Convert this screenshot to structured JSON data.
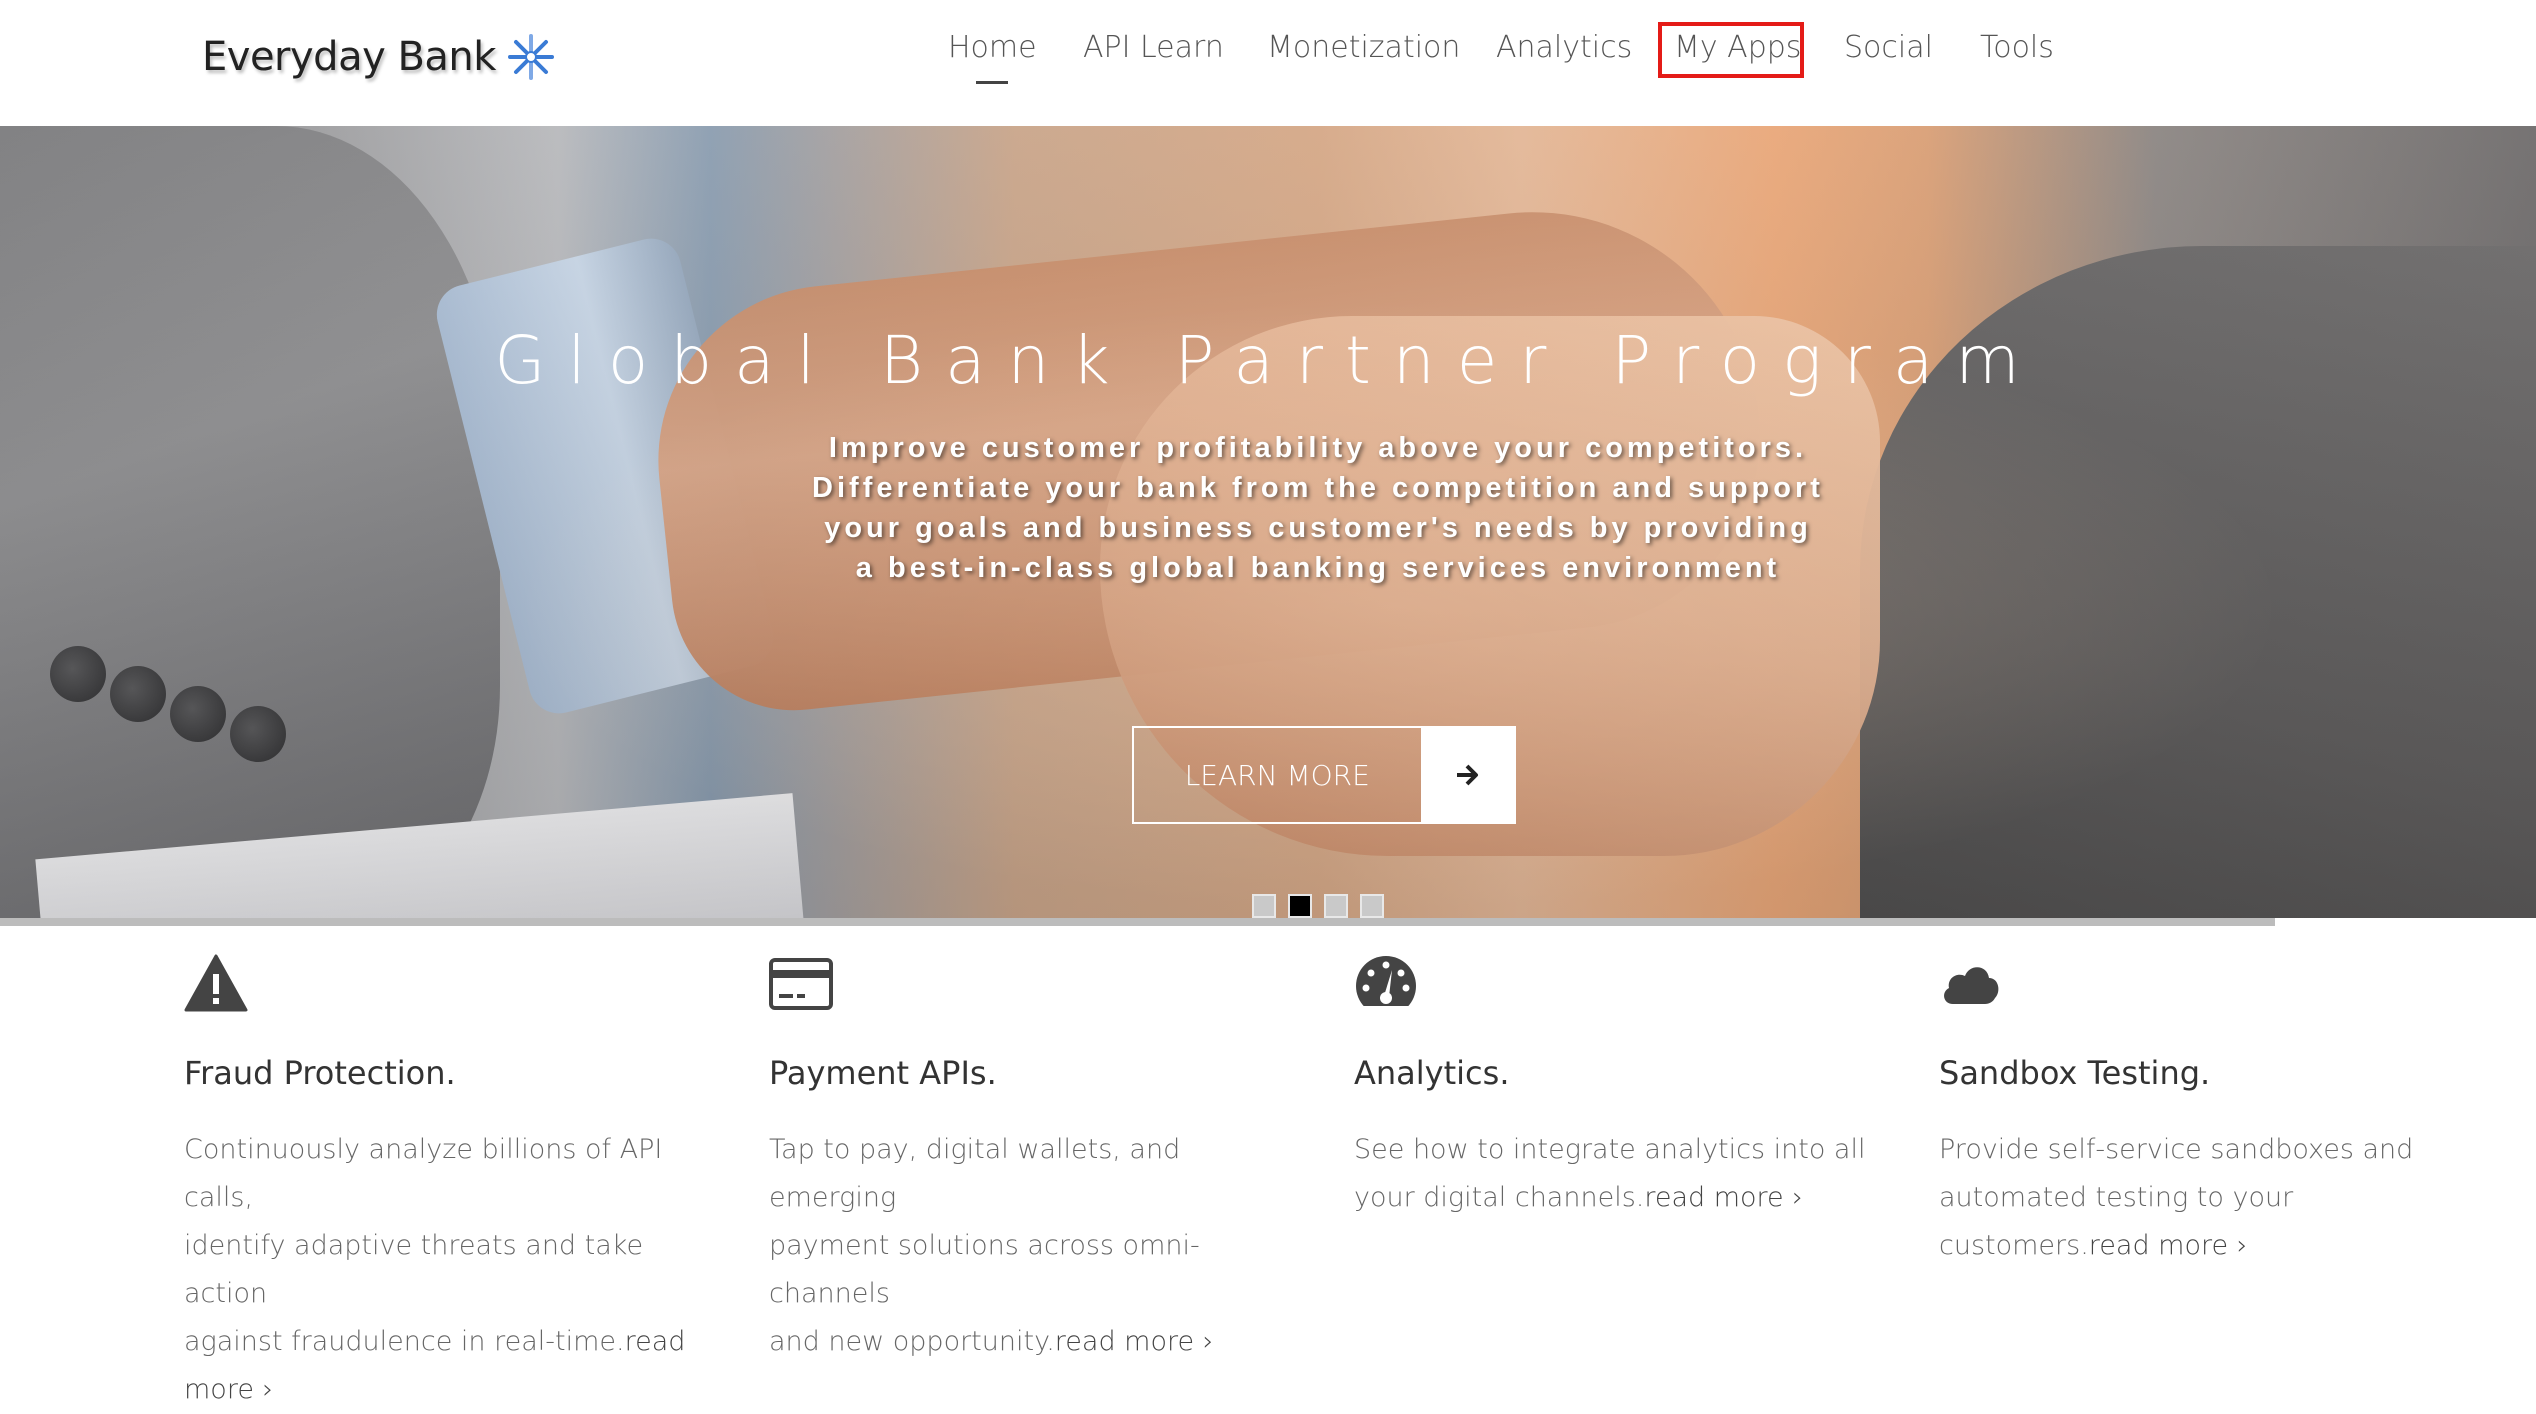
{
  "brand": {
    "name": "Everyday Bank",
    "logo_icon": "star-burst-icon",
    "logo_color": "#3a7bd5"
  },
  "nav": {
    "items": [
      {
        "label": "Home",
        "active": true
      },
      {
        "label": "API Learn"
      },
      {
        "label": "Monetization"
      },
      {
        "label": "Analytics"
      },
      {
        "label": "My Apps",
        "highlighted": true
      },
      {
        "label": "Social"
      },
      {
        "label": "Tools"
      }
    ],
    "highlight_color": "#e41b17"
  },
  "hero": {
    "title": "Global Bank Partner Program",
    "body_lines": [
      "Improve customer profitability above your competitors.",
      "Differentiate your bank from the competition and support",
      "your goals and business customer's needs by providing",
      "a best-in-class global banking services environment"
    ],
    "cta_label": "LEARN MORE",
    "cta_icon": "arrow-right-icon",
    "carousel": {
      "slide_count": 4,
      "active_index": 1
    },
    "progress_fraction": 0.897
  },
  "features": [
    {
      "icon": "warning-triangle-icon",
      "title": "Fraud Protection.",
      "desc_lines": [
        "Continuously analyze billions of API calls,",
        "identify adaptive threats and take action",
        "against fraudulence in real-time."
      ],
      "read_more": "read more ›"
    },
    {
      "icon": "credit-card-icon",
      "title": "Payment APIs.",
      "desc_lines": [
        "Tap to pay, digital wallets, and emerging",
        "payment solutions across omni-channels",
        "and new opportunity."
      ],
      "read_more": "read more ›"
    },
    {
      "icon": "speedometer-icon",
      "title": "Analytics.",
      "desc_lines": [
        "See how to integrate analytics into all",
        "your digital channels."
      ],
      "read_more": "read more ›"
    },
    {
      "icon": "cloud-icon",
      "title": "Sandbox Testing.",
      "desc_lines": [
        "Provide self-service sandboxes and",
        "automated testing to your customers."
      ],
      "read_more": "read more ›"
    }
  ]
}
